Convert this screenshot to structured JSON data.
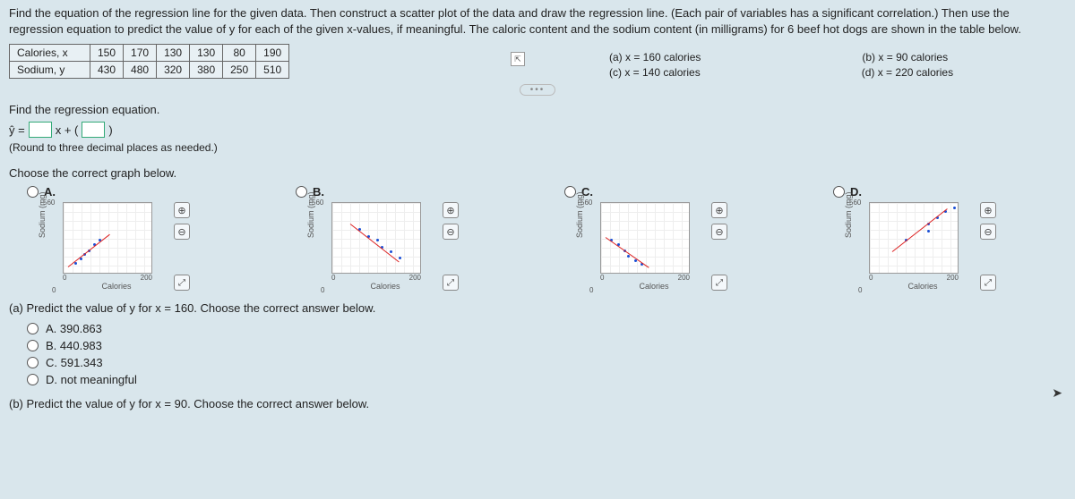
{
  "instructions": "Find the equation of the regression line for the given data. Then construct a scatter plot of the data and draw the regression line. (Each pair of variables has a significant correlation.) Then use the regression equation to predict the value of y for each of the given x-values, if meaningful. The caloric content and the sodium content (in milligrams) for 6 beef hot dogs are shown in the table below.",
  "table": {
    "row1_label": "Calories, x",
    "row2_label": "Sodium, y",
    "row1": [
      "150",
      "170",
      "130",
      "130",
      "80",
      "190"
    ],
    "row2": [
      "430",
      "480",
      "320",
      "380",
      "250",
      "510"
    ]
  },
  "subq": {
    "a": "(a) x = 160 calories",
    "b": "(b) x = 90 calories",
    "c": "(c) x = 140 calories",
    "d": "(d) x = 220 calories"
  },
  "find_eq_label": "Find the regression equation.",
  "eq_prefix": "ŷ =",
  "eq_mid": "x + (",
  "eq_suffix": ")",
  "round_hint": "(Round to three decimal places as needed.)",
  "choose_graph_label": "Choose the correct graph below.",
  "graph_labels": {
    "A": "A.",
    "B": "B.",
    "C": "C.",
    "D": "D."
  },
  "axis": {
    "y": "Sodium (mg)",
    "x": "Calories",
    "ymax": "560",
    "ymin": "0",
    "xmin": "0",
    "xmax": "200"
  },
  "predict_a_q": "(a) Predict the value of y for x = 160. Choose the correct answer below.",
  "mc_a": {
    "A": "A.  390.863",
    "B": "B.  440.983",
    "C": "C.  591.343",
    "D": "D.  not meaningful"
  },
  "predict_b_q": "(b) Predict the value of y for x = 90. Choose the correct answer below.",
  "icons": {
    "zoom_in": "⊕",
    "zoom_out": "⊖",
    "expand": "⤢",
    "table_expand": "⇱"
  },
  "chart_data": {
    "type": "scatter",
    "title": "",
    "xlabel": "Calories",
    "ylabel": "Sodium (mg)",
    "xlim": [
      0,
      200
    ],
    "ylim": [
      0,
      560
    ],
    "series": [
      {
        "name": "data",
        "x": [
          150,
          170,
          130,
          130,
          80,
          190
        ],
        "y": [
          430,
          480,
          320,
          380,
          250,
          510
        ]
      }
    ],
    "variants": {
      "A": {
        "points_region": "lower-left",
        "line": "up-right"
      },
      "B": {
        "points_region": "center",
        "line": "down-right"
      },
      "C": {
        "points_region": "lower-left",
        "line": "down-right"
      },
      "D": {
        "points_region": "upper-right",
        "line": "up-right"
      }
    }
  }
}
